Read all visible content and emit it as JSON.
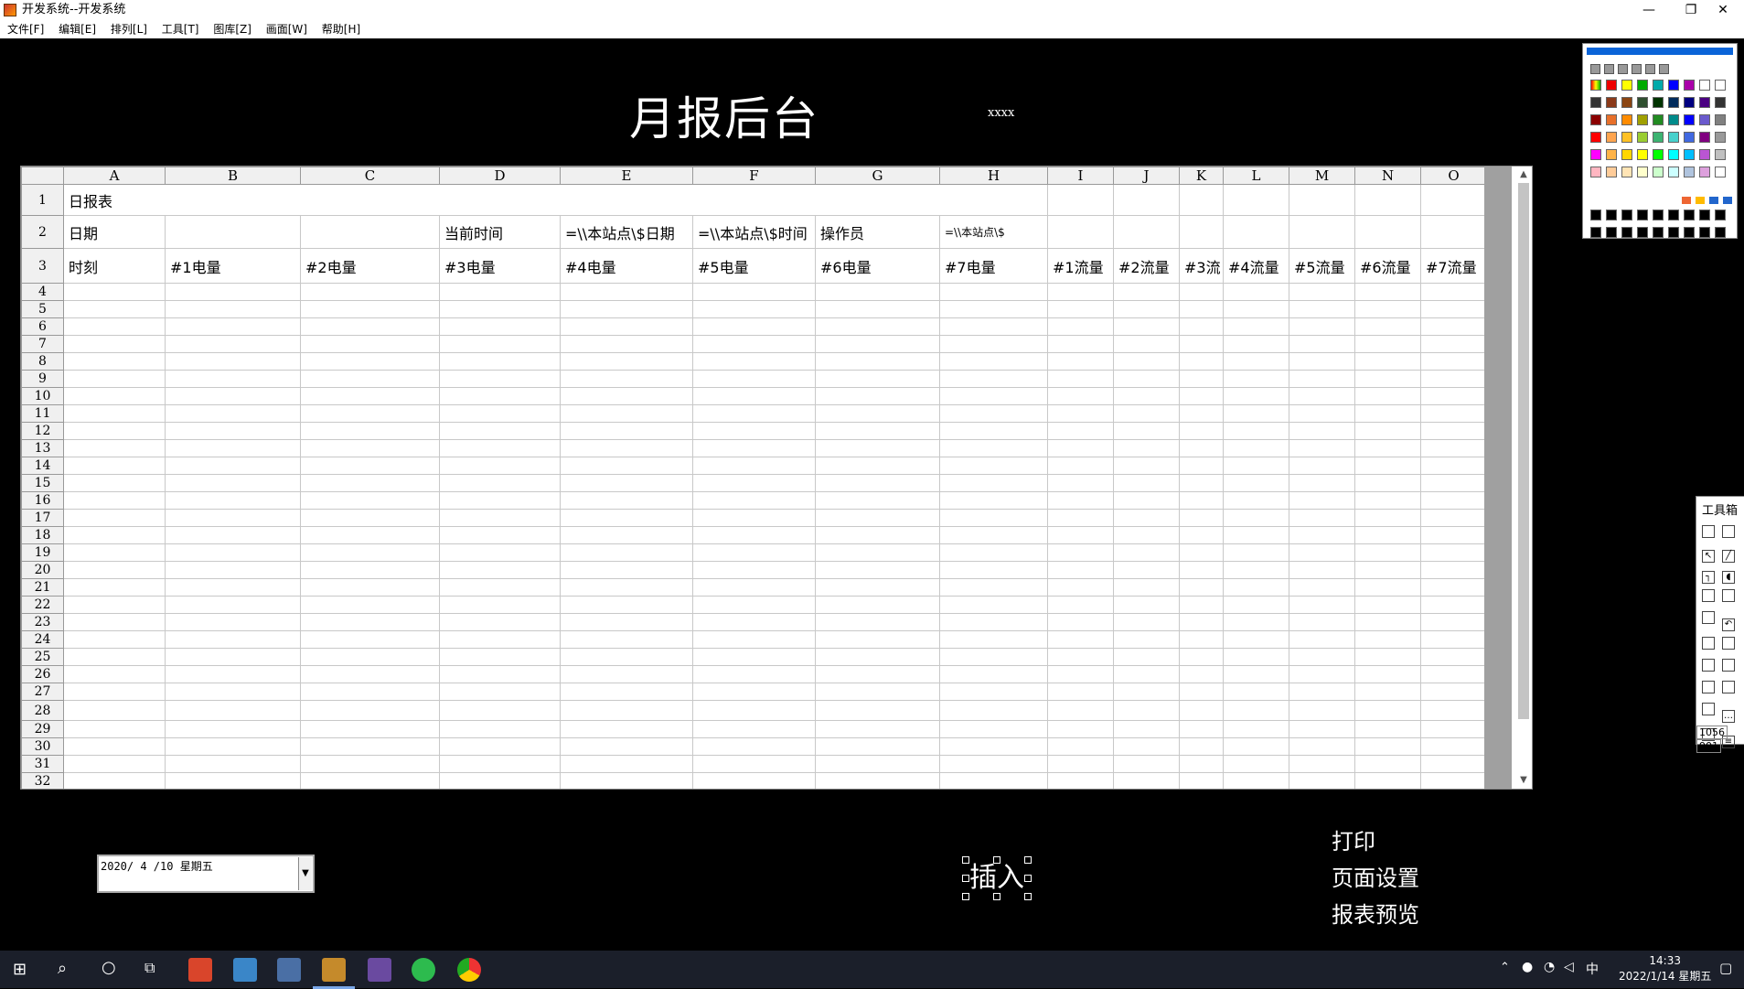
{
  "window": {
    "title": "开发系统--开发系统",
    "min_glyph": "—",
    "restore_glyph": "❐",
    "close_glyph": "✕"
  },
  "menu": [
    "文件[F]",
    "编辑[E]",
    "排列[L]",
    "工具[T]",
    "图库[Z]",
    "画面[W]",
    "帮助[H]"
  ],
  "canvas": {
    "title": "月报后台",
    "label": "xxxx"
  },
  "sheet": {
    "columns": [
      "A",
      "B",
      "C",
      "D",
      "E",
      "F",
      "G",
      "H",
      "I",
      "J",
      "K",
      "L",
      "M",
      "N",
      "O"
    ],
    "row1": [
      "日报表"
    ],
    "row2": [
      "日期",
      "",
      "",
      "当前时间",
      "=\\\\本站点\\$日期",
      "=\\\\本站点\\$时间",
      "操作员",
      "=\\\\本站点\\$",
      "",
      "",
      "",
      "",
      "",
      "",
      ""
    ],
    "row3": [
      "时刻",
      "#1电量",
      "#2电量",
      "#3电量",
      "#4电量",
      "#5电量",
      "#6电量",
      "#7电量",
      "#1流量",
      "#2流量",
      "#3流",
      "#4流量",
      "#5流量",
      "#6流量",
      "#7流量"
    ],
    "row_numbers": [
      "1",
      "2",
      "3",
      "4",
      "5",
      "6",
      "7",
      "8",
      "9",
      "10",
      "11",
      "12",
      "13",
      "14",
      "15",
      "16",
      "17",
      "18",
      "19",
      "20",
      "21",
      "22",
      "23",
      "24",
      "25",
      "26",
      "27",
      "28",
      "29",
      "30",
      "31",
      "32"
    ]
  },
  "toolbox": {
    "title": "工具箱",
    "x": "1056",
    "y": "901"
  },
  "datepicker": {
    "value": "2020/ 4 /10 星期五"
  },
  "buttons": {
    "insert": "插入",
    "print": "打印",
    "page_setup": "页面设置",
    "preview": "报表预览"
  },
  "taskbar": {
    "ime": "中",
    "time": "14:33",
    "date": "2022/1/14 星期五"
  },
  "colors": {
    "accent": "#0a64d8",
    "taskbar": "#1b1f2a"
  }
}
